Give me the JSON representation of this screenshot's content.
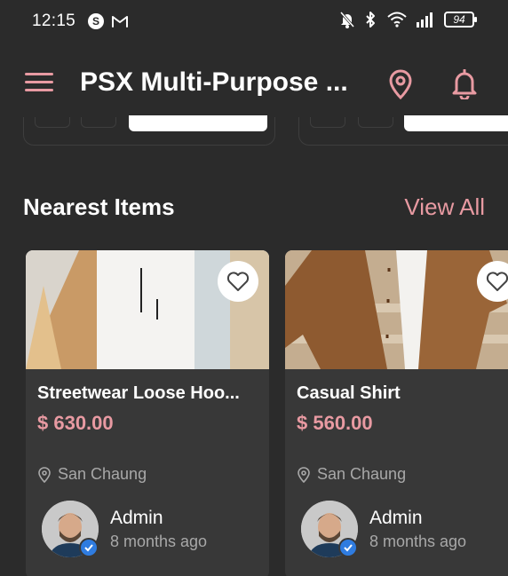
{
  "status_bar": {
    "time": "12:15",
    "left_icons": [
      "skype-icon",
      "gmail-icon"
    ],
    "right_icons": [
      "mute-icon",
      "bluetooth-icon",
      "wifi-icon",
      "signal-icon"
    ],
    "battery": "94"
  },
  "app_bar": {
    "title": "PSX Multi-Purpose ...",
    "icons": [
      "menu-icon",
      "location-icon",
      "bell-icon"
    ],
    "accent": "#e89aa2"
  },
  "section": {
    "title": "Nearest Items",
    "view_all": "View All"
  },
  "items": [
    {
      "title": "Streetwear Loose Hoo...",
      "price": "$ 630.00",
      "location": "San Chaung",
      "owner": "Admin",
      "time": "8 months ago"
    },
    {
      "title": "Casual Shirt",
      "price": "$ 560.00",
      "location": "San Chaung",
      "owner": "Admin",
      "time": "8 months ago"
    }
  ]
}
